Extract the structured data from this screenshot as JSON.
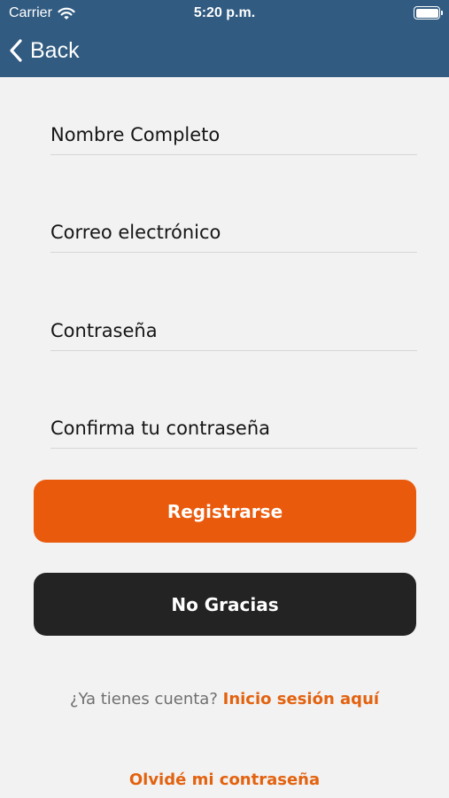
{
  "status_bar": {
    "carrier": "Carrier",
    "time": "5:20 p.m."
  },
  "nav": {
    "back_label": "Back"
  },
  "form": {
    "full_name_placeholder": "Nombre Completo",
    "email_placeholder": "Correo electrónico",
    "password_placeholder": "Contraseña",
    "confirm_password_placeholder": "Confirma tu contraseña"
  },
  "buttons": {
    "register_label": "Registrarse",
    "no_thanks_label": "No Gracias"
  },
  "login": {
    "question": "¿Ya tienes cuenta?",
    "link": "Inicio sesión aquí"
  },
  "forgot_password": "Olvidé mi contraseña",
  "colors": {
    "header": "#315b81",
    "accent": "#ea5a0c",
    "dark_button": "#232323",
    "background": "#f2f2f2"
  },
  "icons": {
    "wifi": "wifi-icon",
    "battery": "battery-icon",
    "back": "chevron-left-icon"
  }
}
